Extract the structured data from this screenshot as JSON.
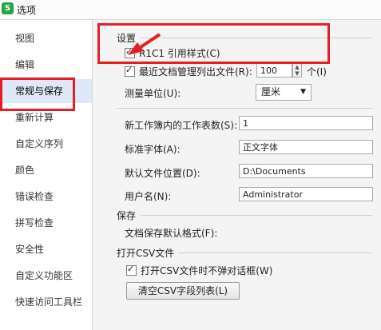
{
  "window": {
    "title": "选项",
    "app_icon": "S"
  },
  "sidebar": {
    "items": [
      {
        "label": "视图"
      },
      {
        "label": "编辑"
      },
      {
        "label": "常规与保存"
      },
      {
        "label": "重新计算"
      },
      {
        "label": "自定义序列"
      },
      {
        "label": "颜色"
      },
      {
        "label": "错误检查"
      },
      {
        "label": "拼写检查"
      },
      {
        "label": "安全性"
      },
      {
        "label": "自定义功能区"
      },
      {
        "label": "快速访问工具栏"
      }
    ],
    "selected": "常规与保存"
  },
  "settings": {
    "section_title": "设置",
    "r1c1": {
      "label": "R1C1 引用样式(C)",
      "checked": true
    },
    "recent_files": {
      "label": "最近文档管理列出文件(R):",
      "value": "100",
      "unit": "个(I)",
      "checked": true
    },
    "measure_unit": {
      "label": "测量单位(U):",
      "value": "厘米"
    },
    "sheet_count": {
      "label": "新工作簿内的工作表数(S):",
      "value": "1"
    },
    "standard_font": {
      "label": "标准字体(A):",
      "value": "正文字体"
    },
    "default_location": {
      "label": "默认文件位置(D):",
      "value": "D:\\Documents"
    },
    "username": {
      "label": "用户名(N):",
      "value": "Administrator"
    }
  },
  "save": {
    "section_title": "保存",
    "default_format": {
      "label": "文档保存默认格式(F):"
    }
  },
  "csv": {
    "section_title": "打开CSV文件",
    "no_dialog": {
      "label": "打开CSV文件时不弹对话框(W)",
      "checked": true
    },
    "clear_button": "清空CSV字段列表(L)"
  },
  "colors": {
    "highlight": "#e31e25",
    "selected_bg": "#dfe8f7"
  }
}
